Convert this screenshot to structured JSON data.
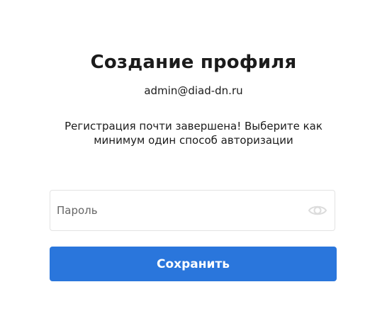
{
  "header": {
    "title": "Создание профиля",
    "email": "admin@diad-dn.ru"
  },
  "message": {
    "line1": "Регистрация почти завершена! Выберите как",
    "line2": "минимум один способ авторизации"
  },
  "password": {
    "placeholder": "Пароль",
    "value": "",
    "toggle_icon": "eye-icon"
  },
  "actions": {
    "save_label": "Сохранить",
    "save_color": "#2a76dc"
  }
}
